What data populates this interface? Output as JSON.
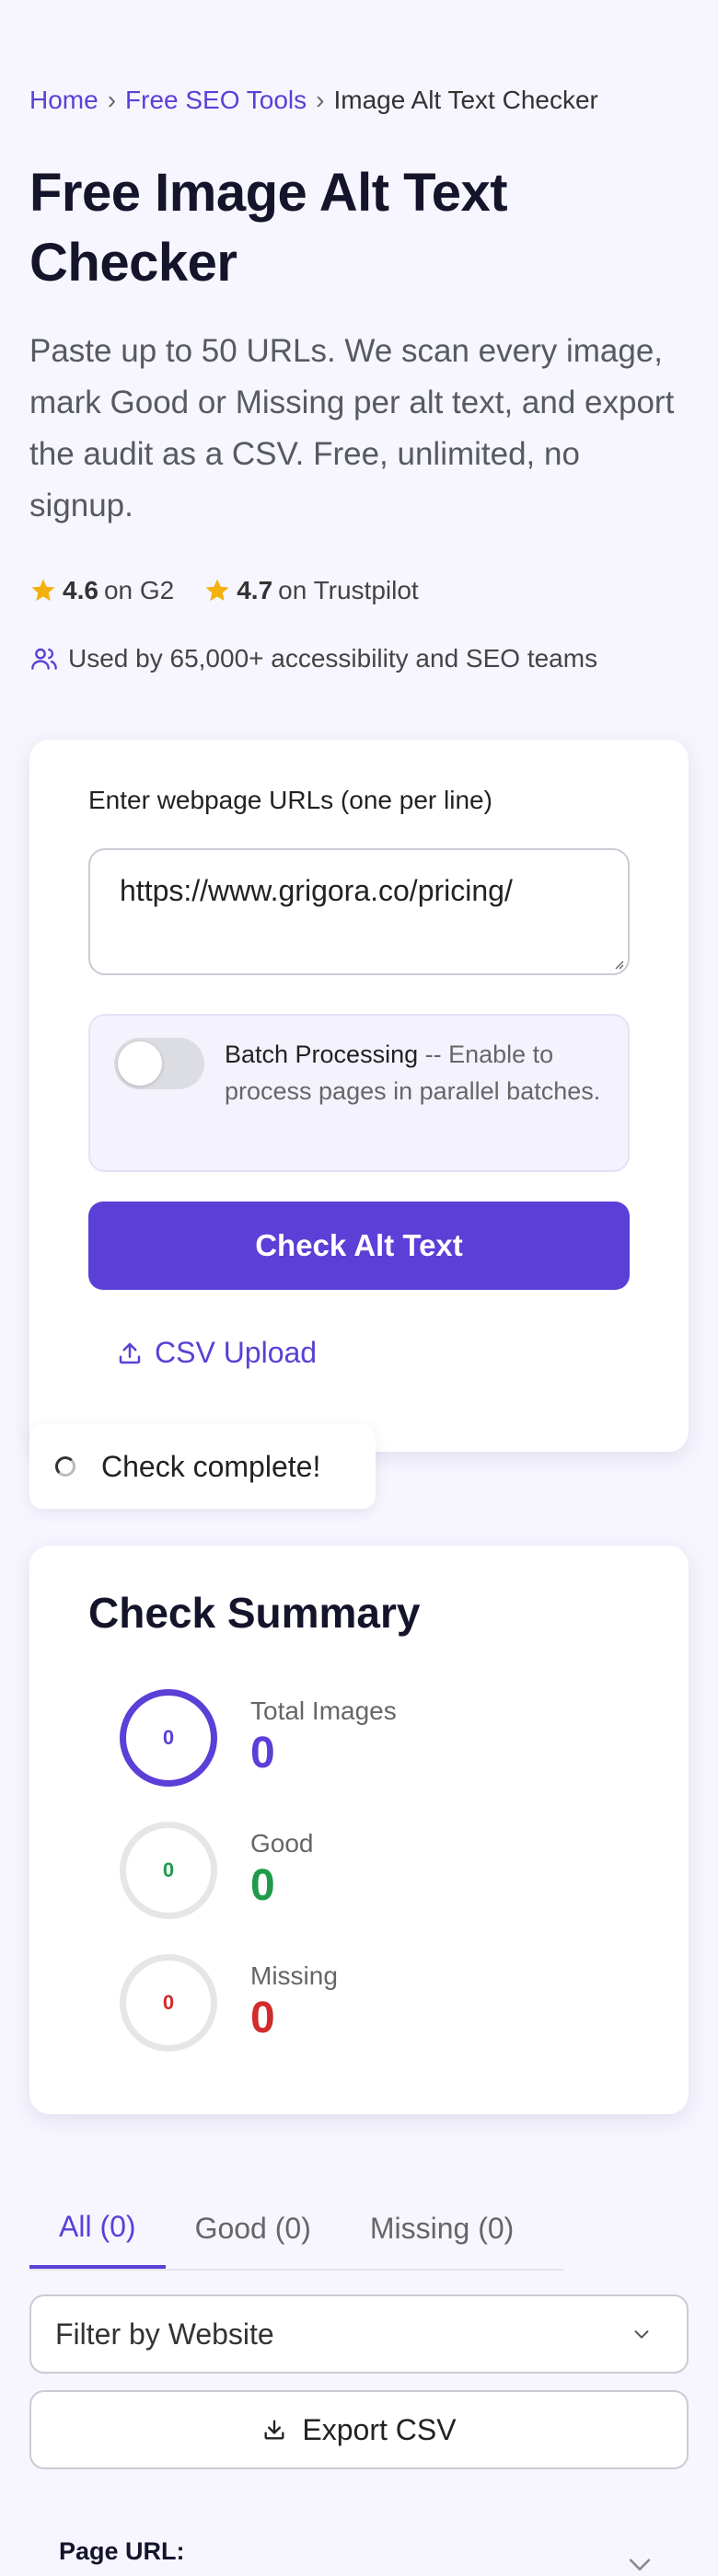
{
  "breadcrumb": {
    "home": "Home",
    "tools": "Free SEO Tools",
    "current": "Image Alt Text Checker",
    "separator": "›"
  },
  "hero": {
    "title": "Free Image Alt Text Checker",
    "description": "Paste up to 50 URLs. We scan every image, mark Good or Missing per alt text, and export the audit as a CSV. Free, unlimited, no signup."
  },
  "ratings": [
    {
      "score": "4.6",
      "source": "on G2"
    },
    {
      "score": "4.7",
      "source": "on Trustpilot"
    }
  ],
  "used_by": "Used by 65,000+ accessibility and SEO teams",
  "form": {
    "label": "Enter webpage URLs (one per line)",
    "url_value": "https://www.grigora.co/pricing/",
    "batch_title": "Batch Processing",
    "batch_desc": " -- Enable to process pages in parallel batches.",
    "check_button": "Check Alt Text",
    "csv_upload": "CSV Upload"
  },
  "toast": {
    "message": "Check complete!"
  },
  "summary": {
    "title": "Check Summary",
    "stats": [
      {
        "label": "Total Images",
        "value": "0",
        "ring": "0",
        "color": "#5b3fd6"
      },
      {
        "label": "Good",
        "value": "0",
        "ring": "0",
        "color": "#1f9a4b"
      },
      {
        "label": "Missing",
        "value": "0",
        "ring": "0",
        "color": "#d12b2b"
      }
    ]
  },
  "tabs": [
    {
      "label": "All (0)",
      "active": true
    },
    {
      "label": "Good (0)",
      "active": false
    },
    {
      "label": "Missing (0)",
      "active": false
    }
  ],
  "filter": {
    "selected": "Filter by Website"
  },
  "export_button": "Export CSV",
  "result": {
    "page_url_label": "Page URL:"
  },
  "colors": {
    "accent": "#5b3fd6",
    "good": "#1f9a4b",
    "missing": "#d12b2b",
    "star": "#f2b10c"
  }
}
